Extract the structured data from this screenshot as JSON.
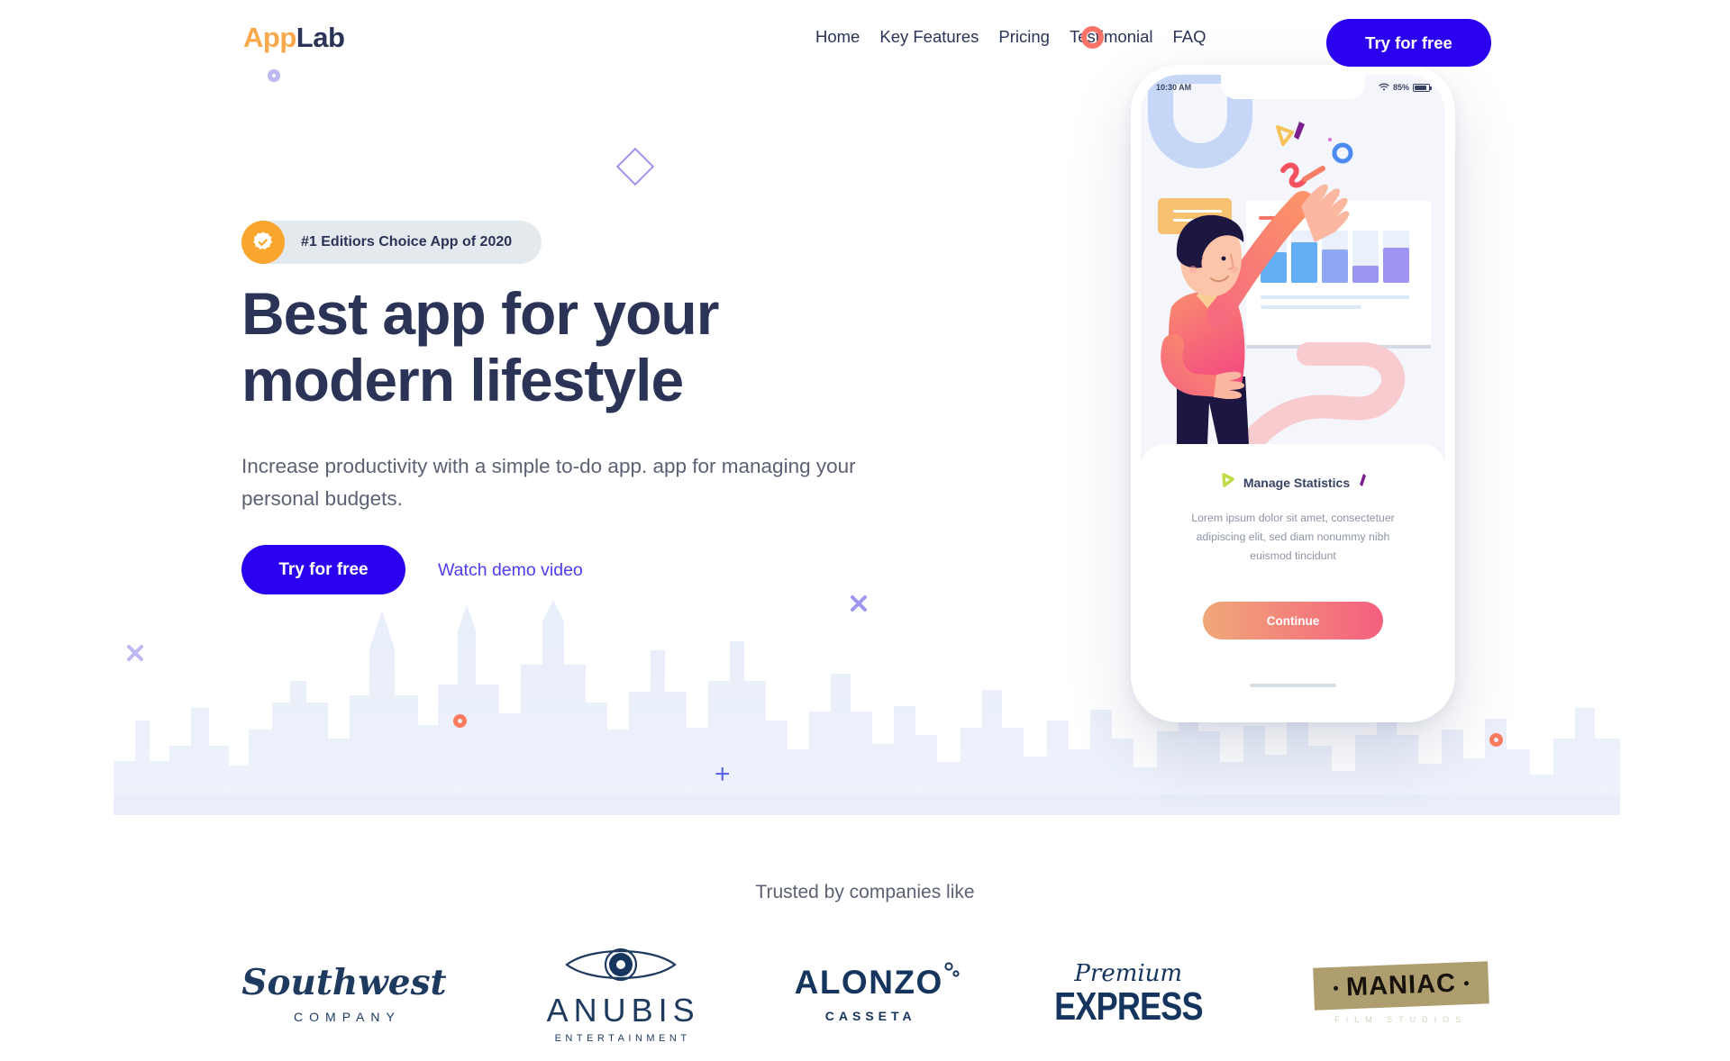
{
  "brand": {
    "name_part1": "App",
    "name_part2": "Lab"
  },
  "header": {
    "nav_items": [
      {
        "label": "Home"
      },
      {
        "label": "Key Features"
      },
      {
        "label": "Pricing"
      },
      {
        "label": "Testimonial"
      },
      {
        "label": "FAQ"
      }
    ],
    "cta_label": "Try for free"
  },
  "hero": {
    "badge_text": "#1 Editiors Choice App of 2020",
    "badge_icon": "verified-badge-icon",
    "title_line1": "Best app for your",
    "title_line2": "modern lifestyle",
    "subtitle": "Increase productivity with a simple to-do app. app for managing your personal budgets.",
    "primary_cta": "Try for free",
    "secondary_cta": "Watch demo video"
  },
  "phone": {
    "status": {
      "time": "10:30 AM",
      "battery_percent": "85%",
      "wifi_icon": "wifi-icon",
      "battery_icon": "battery-icon"
    },
    "card": {
      "title": "Manage Statistics",
      "body": "Lorem ipsum dolor sit amet, consectetuer adipiscing elit, sed diam nonummy nibh euismod tincidunt",
      "button_label": "Continue"
    }
  },
  "trusted": {
    "label": "Trusted by companies like",
    "logos": [
      {
        "name": "southwest",
        "main": "Southwest",
        "sub": "COMPANY"
      },
      {
        "name": "anubis",
        "main": "ANUBIS",
        "sub": "ENTERTAINMENT"
      },
      {
        "name": "alonzo",
        "main": "ALONZO",
        "sub": "CASSETA"
      },
      {
        "name": "premium-express",
        "main": "EXPRESS",
        "sub": "Premium"
      },
      {
        "name": "maniac",
        "main": "MANIAC",
        "sub": "FILM STUDIOS"
      }
    ]
  },
  "colors": {
    "brand_orange": "#F9A94B",
    "brand_navy": "#2B3357",
    "cta_blue": "#2A00EE",
    "link_blue": "#4C3EF0",
    "badge_bg": "#E3E9EC",
    "badge_icon_bg": "#F9A52E",
    "accent_coral": "#FB7268",
    "accent_purple": "#9F96F0",
    "skyline_blue": "#EAEFFA",
    "logo_navy": "#15355E",
    "maniac_gold": "#AE9E6F"
  }
}
